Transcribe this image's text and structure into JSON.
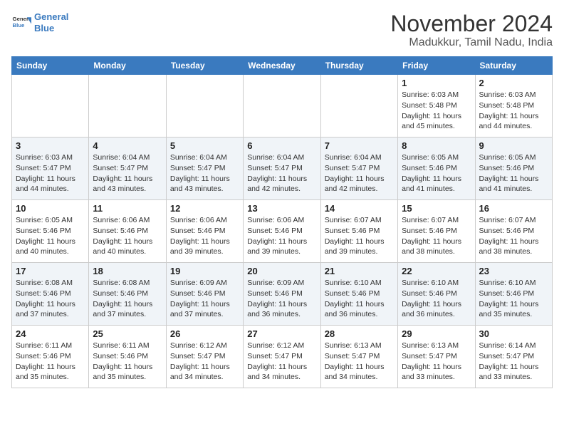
{
  "logo": {
    "line1": "General",
    "line2": "Blue"
  },
  "title": "November 2024",
  "location": "Madukkur, Tamil Nadu, India",
  "days_of_week": [
    "Sunday",
    "Monday",
    "Tuesday",
    "Wednesday",
    "Thursday",
    "Friday",
    "Saturday"
  ],
  "weeks": [
    [
      {
        "day": "",
        "info": ""
      },
      {
        "day": "",
        "info": ""
      },
      {
        "day": "",
        "info": ""
      },
      {
        "day": "",
        "info": ""
      },
      {
        "day": "",
        "info": ""
      },
      {
        "day": "1",
        "info": "Sunrise: 6:03 AM\nSunset: 5:48 PM\nDaylight: 11 hours and 45 minutes."
      },
      {
        "day": "2",
        "info": "Sunrise: 6:03 AM\nSunset: 5:48 PM\nDaylight: 11 hours and 44 minutes."
      }
    ],
    [
      {
        "day": "3",
        "info": "Sunrise: 6:03 AM\nSunset: 5:47 PM\nDaylight: 11 hours and 44 minutes."
      },
      {
        "day": "4",
        "info": "Sunrise: 6:04 AM\nSunset: 5:47 PM\nDaylight: 11 hours and 43 minutes."
      },
      {
        "day": "5",
        "info": "Sunrise: 6:04 AM\nSunset: 5:47 PM\nDaylight: 11 hours and 43 minutes."
      },
      {
        "day": "6",
        "info": "Sunrise: 6:04 AM\nSunset: 5:47 PM\nDaylight: 11 hours and 42 minutes."
      },
      {
        "day": "7",
        "info": "Sunrise: 6:04 AM\nSunset: 5:47 PM\nDaylight: 11 hours and 42 minutes."
      },
      {
        "day": "8",
        "info": "Sunrise: 6:05 AM\nSunset: 5:46 PM\nDaylight: 11 hours and 41 minutes."
      },
      {
        "day": "9",
        "info": "Sunrise: 6:05 AM\nSunset: 5:46 PM\nDaylight: 11 hours and 41 minutes."
      }
    ],
    [
      {
        "day": "10",
        "info": "Sunrise: 6:05 AM\nSunset: 5:46 PM\nDaylight: 11 hours and 40 minutes."
      },
      {
        "day": "11",
        "info": "Sunrise: 6:06 AM\nSunset: 5:46 PM\nDaylight: 11 hours and 40 minutes."
      },
      {
        "day": "12",
        "info": "Sunrise: 6:06 AM\nSunset: 5:46 PM\nDaylight: 11 hours and 39 minutes."
      },
      {
        "day": "13",
        "info": "Sunrise: 6:06 AM\nSunset: 5:46 PM\nDaylight: 11 hours and 39 minutes."
      },
      {
        "day": "14",
        "info": "Sunrise: 6:07 AM\nSunset: 5:46 PM\nDaylight: 11 hours and 39 minutes."
      },
      {
        "day": "15",
        "info": "Sunrise: 6:07 AM\nSunset: 5:46 PM\nDaylight: 11 hours and 38 minutes."
      },
      {
        "day": "16",
        "info": "Sunrise: 6:07 AM\nSunset: 5:46 PM\nDaylight: 11 hours and 38 minutes."
      }
    ],
    [
      {
        "day": "17",
        "info": "Sunrise: 6:08 AM\nSunset: 5:46 PM\nDaylight: 11 hours and 37 minutes."
      },
      {
        "day": "18",
        "info": "Sunrise: 6:08 AM\nSunset: 5:46 PM\nDaylight: 11 hours and 37 minutes."
      },
      {
        "day": "19",
        "info": "Sunrise: 6:09 AM\nSunset: 5:46 PM\nDaylight: 11 hours and 37 minutes."
      },
      {
        "day": "20",
        "info": "Sunrise: 6:09 AM\nSunset: 5:46 PM\nDaylight: 11 hours and 36 minutes."
      },
      {
        "day": "21",
        "info": "Sunrise: 6:10 AM\nSunset: 5:46 PM\nDaylight: 11 hours and 36 minutes."
      },
      {
        "day": "22",
        "info": "Sunrise: 6:10 AM\nSunset: 5:46 PM\nDaylight: 11 hours and 36 minutes."
      },
      {
        "day": "23",
        "info": "Sunrise: 6:10 AM\nSunset: 5:46 PM\nDaylight: 11 hours and 35 minutes."
      }
    ],
    [
      {
        "day": "24",
        "info": "Sunrise: 6:11 AM\nSunset: 5:46 PM\nDaylight: 11 hours and 35 minutes."
      },
      {
        "day": "25",
        "info": "Sunrise: 6:11 AM\nSunset: 5:46 PM\nDaylight: 11 hours and 35 minutes."
      },
      {
        "day": "26",
        "info": "Sunrise: 6:12 AM\nSunset: 5:47 PM\nDaylight: 11 hours and 34 minutes."
      },
      {
        "day": "27",
        "info": "Sunrise: 6:12 AM\nSunset: 5:47 PM\nDaylight: 11 hours and 34 minutes."
      },
      {
        "day": "28",
        "info": "Sunrise: 6:13 AM\nSunset: 5:47 PM\nDaylight: 11 hours and 34 minutes."
      },
      {
        "day": "29",
        "info": "Sunrise: 6:13 AM\nSunset: 5:47 PM\nDaylight: 11 hours and 33 minutes."
      },
      {
        "day": "30",
        "info": "Sunrise: 6:14 AM\nSunset: 5:47 PM\nDaylight: 11 hours and 33 minutes."
      }
    ]
  ]
}
